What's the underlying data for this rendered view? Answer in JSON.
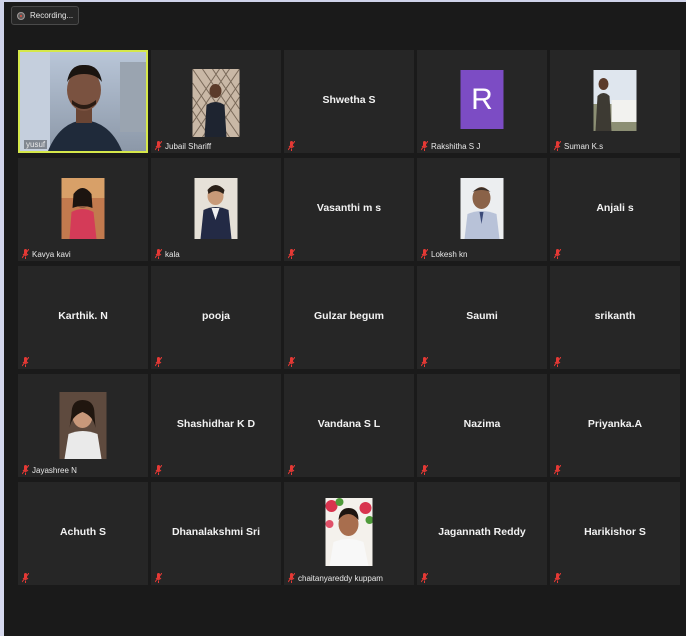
{
  "recording": {
    "label": "Recording..."
  },
  "participants": [
    {
      "name": "yusuf",
      "display": "video"
    },
    {
      "name": "Jubail Shariff",
      "display": "photo"
    },
    {
      "name": "Shwetha S",
      "display": "name"
    },
    {
      "name": "Rakshitha S J",
      "display": "avatar",
      "initial": "R"
    },
    {
      "name": "Suman K.s",
      "display": "photo"
    },
    {
      "name": "Kavya kavi",
      "display": "photo"
    },
    {
      "name": "kala",
      "display": "photo"
    },
    {
      "name": "Vasanthi m s",
      "display": "name"
    },
    {
      "name": "Lokesh kn",
      "display": "photo"
    },
    {
      "name": "Anjali s",
      "display": "name"
    },
    {
      "name": "Karthik. N",
      "display": "name"
    },
    {
      "name": "pooja",
      "display": "name"
    },
    {
      "name": "Gulzar begum",
      "display": "name"
    },
    {
      "name": "Saumi",
      "display": "name"
    },
    {
      "name": "srikanth",
      "display": "name"
    },
    {
      "name": "Jayashree N",
      "display": "photo"
    },
    {
      "name": "Shashidhar K D",
      "display": "name"
    },
    {
      "name": "Vandana S L",
      "display": "name"
    },
    {
      "name": "Nazima",
      "display": "name"
    },
    {
      "name": "Priyanka.A",
      "display": "name"
    },
    {
      "name": "Achuth S",
      "display": "name"
    },
    {
      "name": "Dhanalakshmi Sri",
      "display": "name"
    },
    {
      "name": "chaitanyareddy kuppam",
      "display": "photo"
    },
    {
      "name": "Jagannath Reddy",
      "display": "name"
    },
    {
      "name": "Harikishor S",
      "display": "name"
    }
  ],
  "colors": {
    "muted_mic": "#e53935",
    "active_speaker": "#d6e84a",
    "avatar_bg": "#7c4cc4"
  }
}
